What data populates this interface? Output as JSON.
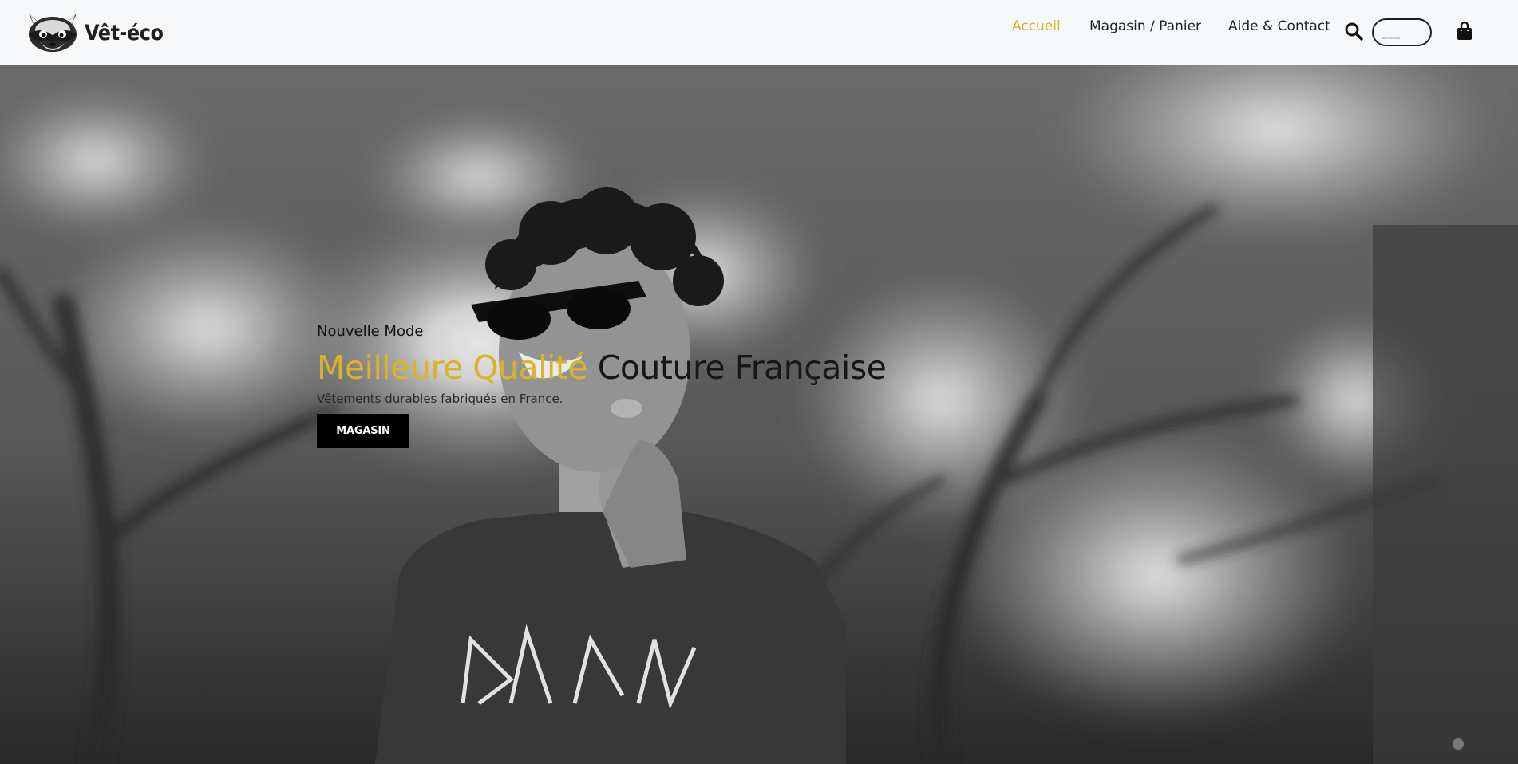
{
  "brand": {
    "name": "Vêt-éco",
    "logo_icon": "raccoon-icon"
  },
  "nav": {
    "items": [
      {
        "label": "Accueil",
        "active": true
      },
      {
        "label": "Magasin / Panier",
        "active": false
      },
      {
        "label": "Aide & Contact",
        "active": false
      }
    ],
    "search": {
      "icon": "search-icon",
      "placeholder": "___",
      "value": ""
    },
    "cart": {
      "icon": "shopping-bag-icon"
    }
  },
  "hero": {
    "kicker": "Nouvelle Mode",
    "title_accent": "Meilleure Qualité",
    "title_rest": "Couture Française",
    "subtitle": "Vêtements durables fabriqués en France.",
    "cta_label": "MAGASIN"
  },
  "colors": {
    "accent": "#d8b42c",
    "nav_background": "#f7f8fa",
    "text_dark": "#16171b",
    "button": "#000000"
  }
}
